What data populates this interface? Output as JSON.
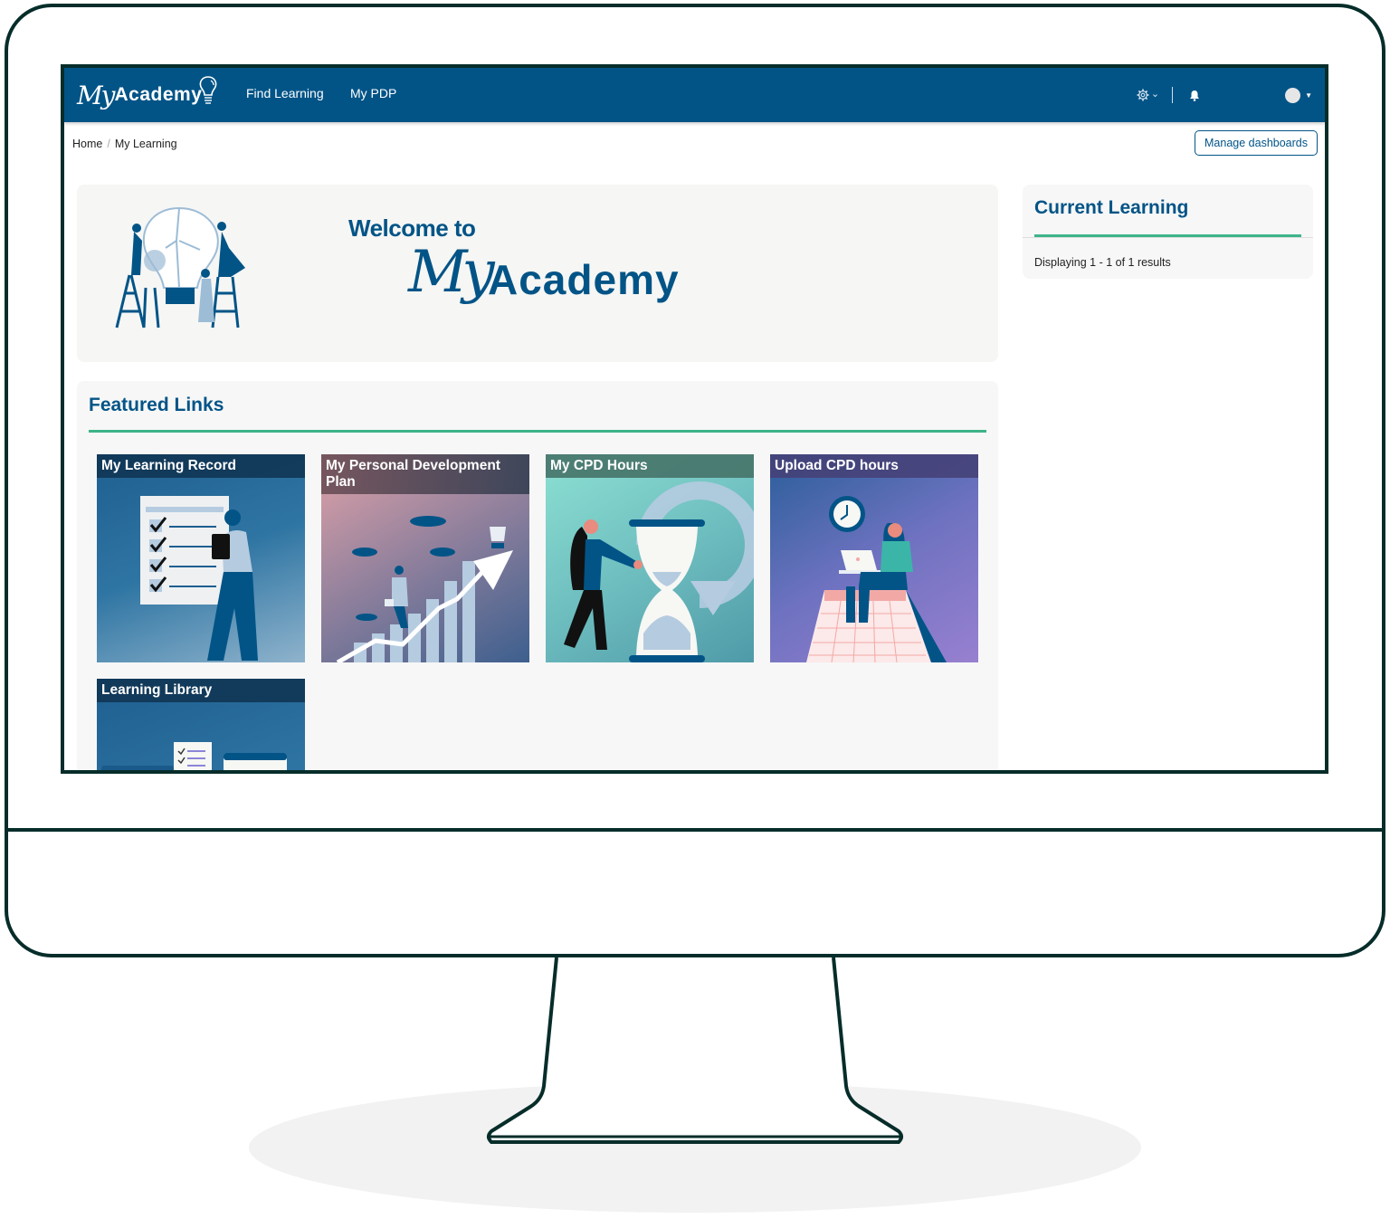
{
  "navbar": {
    "brand_my": "My",
    "brand_academy": "Academy",
    "links": [
      {
        "label": "Find Learning"
      },
      {
        "label": "My PDP"
      }
    ],
    "icons": {
      "settings": "gear-icon",
      "notifications": "bell-icon",
      "user": "avatar"
    },
    "settings_caret": "⌄",
    "user_caret": "▼"
  },
  "breadcrumb": {
    "items": [
      "Home",
      "My Learning"
    ],
    "separator": "/"
  },
  "manage_dashboards_label": "Manage dashboards",
  "welcome": {
    "line1": "Welcome to",
    "my": "My",
    "academy": "Academy"
  },
  "featured": {
    "title": "Featured Links",
    "tiles": [
      {
        "label": "My Learning Record"
      },
      {
        "label": "My Personal Development Plan"
      },
      {
        "label": "My CPD Hours"
      },
      {
        "label": "Upload CPD hours"
      },
      {
        "label": "Learning Library"
      }
    ]
  },
  "current_learning": {
    "title": "Current Learning",
    "status": "Displaying 1 - 1 of 1 results"
  },
  "colors": {
    "brand": "#025487",
    "accent": "#3eb489",
    "frame": "#062d2a"
  }
}
